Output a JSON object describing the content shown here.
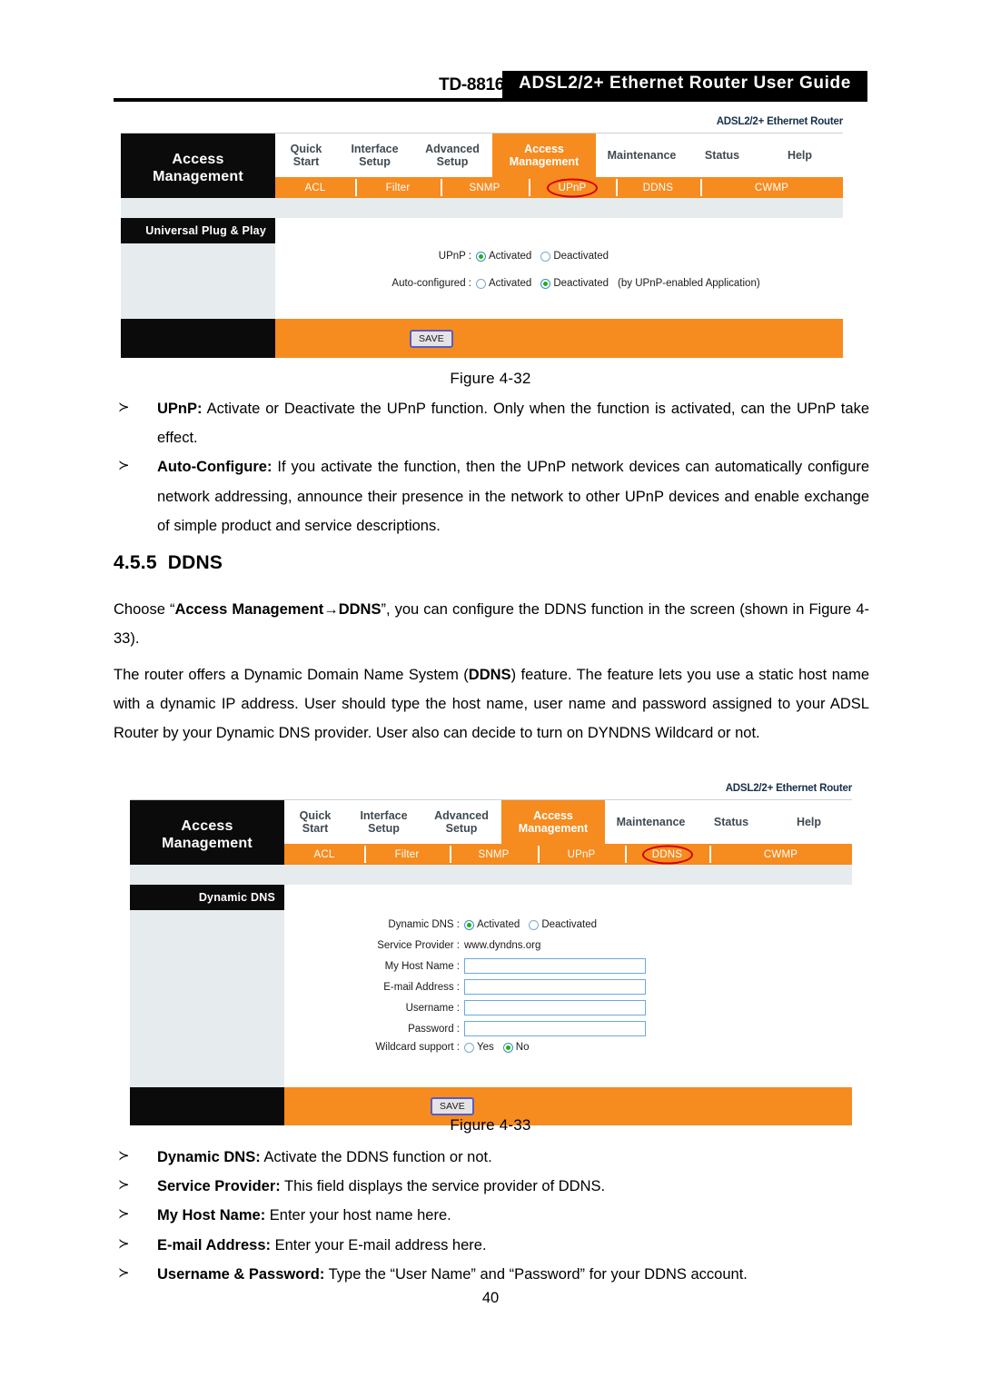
{
  "header": {
    "model": "TD-8816",
    "title": "ADSL2/2+ Ethernet Router User Guide"
  },
  "router_ui": {
    "top_label": "ADSL2/2+ Ethernet Router",
    "brand_line1": "Access",
    "brand_line2": "Management",
    "main_tabs": [
      {
        "line1": "Quick",
        "line2": "Start",
        "active": false
      },
      {
        "line1": "Interface",
        "line2": "Setup",
        "active": false
      },
      {
        "line1": "Advanced",
        "line2": "Setup",
        "active": false
      },
      {
        "line1": "Access",
        "line2": "Management",
        "active": true
      },
      {
        "line1": "Maintenance",
        "line2": "",
        "active": false
      },
      {
        "line1": "Status",
        "line2": "",
        "active": false
      },
      {
        "line1": "Help",
        "line2": "",
        "active": false
      }
    ],
    "sub_tabs": [
      "ACL",
      "Filter",
      "SNMP",
      "UPnP",
      "DDNS",
      "CWMP"
    ],
    "save_label": "SAVE"
  },
  "upnp_panel": {
    "section_title": "Universal Plug & Play",
    "rows": [
      {
        "label": "UPnP :",
        "options": [
          {
            "text": "Activated",
            "selected": true
          },
          {
            "text": "Deactivated",
            "selected": false
          }
        ],
        "suffix": ""
      },
      {
        "label": "Auto-configured :",
        "options": [
          {
            "text": "Activated",
            "selected": false
          },
          {
            "text": "Deactivated",
            "selected": true
          }
        ],
        "suffix": "(by UPnP-enabled Application)"
      }
    ],
    "highlighted_subtab": "UPnP"
  },
  "ddns_panel": {
    "section_title": "Dynamic DNS",
    "dynamic_dns": {
      "label": "Dynamic DNS :",
      "options": [
        {
          "text": "Activated",
          "selected": true
        },
        {
          "text": "Deactivated",
          "selected": false
        }
      ]
    },
    "service_provider": {
      "label": "Service Provider :",
      "value": "www.dyndns.org"
    },
    "fields": [
      {
        "label": "My Host Name :",
        "value": ""
      },
      {
        "label": "E-mail Address :",
        "value": ""
      },
      {
        "label": "Username :",
        "value": ""
      },
      {
        "label": "Password :",
        "value": ""
      }
    ],
    "wildcard": {
      "label": "Wildcard support :",
      "options": [
        {
          "text": "Yes",
          "selected": false
        },
        {
          "text": "No",
          "selected": true
        }
      ]
    },
    "highlighted_subtab": "DDNS"
  },
  "figures": {
    "fig32": "Figure 4-32",
    "fig33": "Figure 4-33"
  },
  "upnp_bullets": [
    {
      "arrow": "≻",
      "bold": "UPnP:",
      "text": " Activate or Deactivate the UPnP function. Only when the function is activated, can the UPnP take effect."
    },
    {
      "arrow": "≻",
      "bold": "Auto-Configure:",
      "text": " If you activate the function, then the UPnP network devices can automatically configure network addressing, announce their presence in the network to other UPnP devices and enable exchange of simple product and service descriptions."
    }
  ],
  "ddns_section": {
    "number": "4.5.5",
    "heading": "DDNS",
    "para1_pre": "Choose “",
    "para1_bold": "Access Management→DDNS",
    "para1_post": "”, you can configure the DDNS function in the screen (shown in Figure 4-33).",
    "para2_pre": "The router offers a Dynamic Domain Name System (",
    "para2_bold": "DDNS",
    "para2_post": ") feature. The feature lets you use a static host name with a dynamic IP address. User should type the host name, user name and password assigned to your ADSL Router by your Dynamic DNS provider. User also can decide to turn on DYNDNS Wildcard or not."
  },
  "ddns_bullets": [
    {
      "arrow": "≻",
      "bold": "Dynamic DNS:",
      "text": " Activate the DDNS function or not."
    },
    {
      "arrow": "≻",
      "bold": "Service Provider:",
      "text": " This field displays the service provider of DDNS."
    },
    {
      "arrow": "≻",
      "bold": "My Host Name:",
      "text": " Enter your host name here."
    },
    {
      "arrow": "≻",
      "bold": "E-mail Address:",
      "text": " Enter your E-mail address here."
    },
    {
      "arrow": "≻",
      "bold": "Username & Password:",
      "text": " Type the “User Name” and “Password” for your DDNS account."
    }
  ],
  "page_number": "40",
  "colors": {
    "orange": "#F68B1F",
    "black_bar": "#0B0B0B",
    "light_band": "#E6ECED",
    "annotation_red": "#D40000",
    "input_border": "#6AA9E0"
  }
}
